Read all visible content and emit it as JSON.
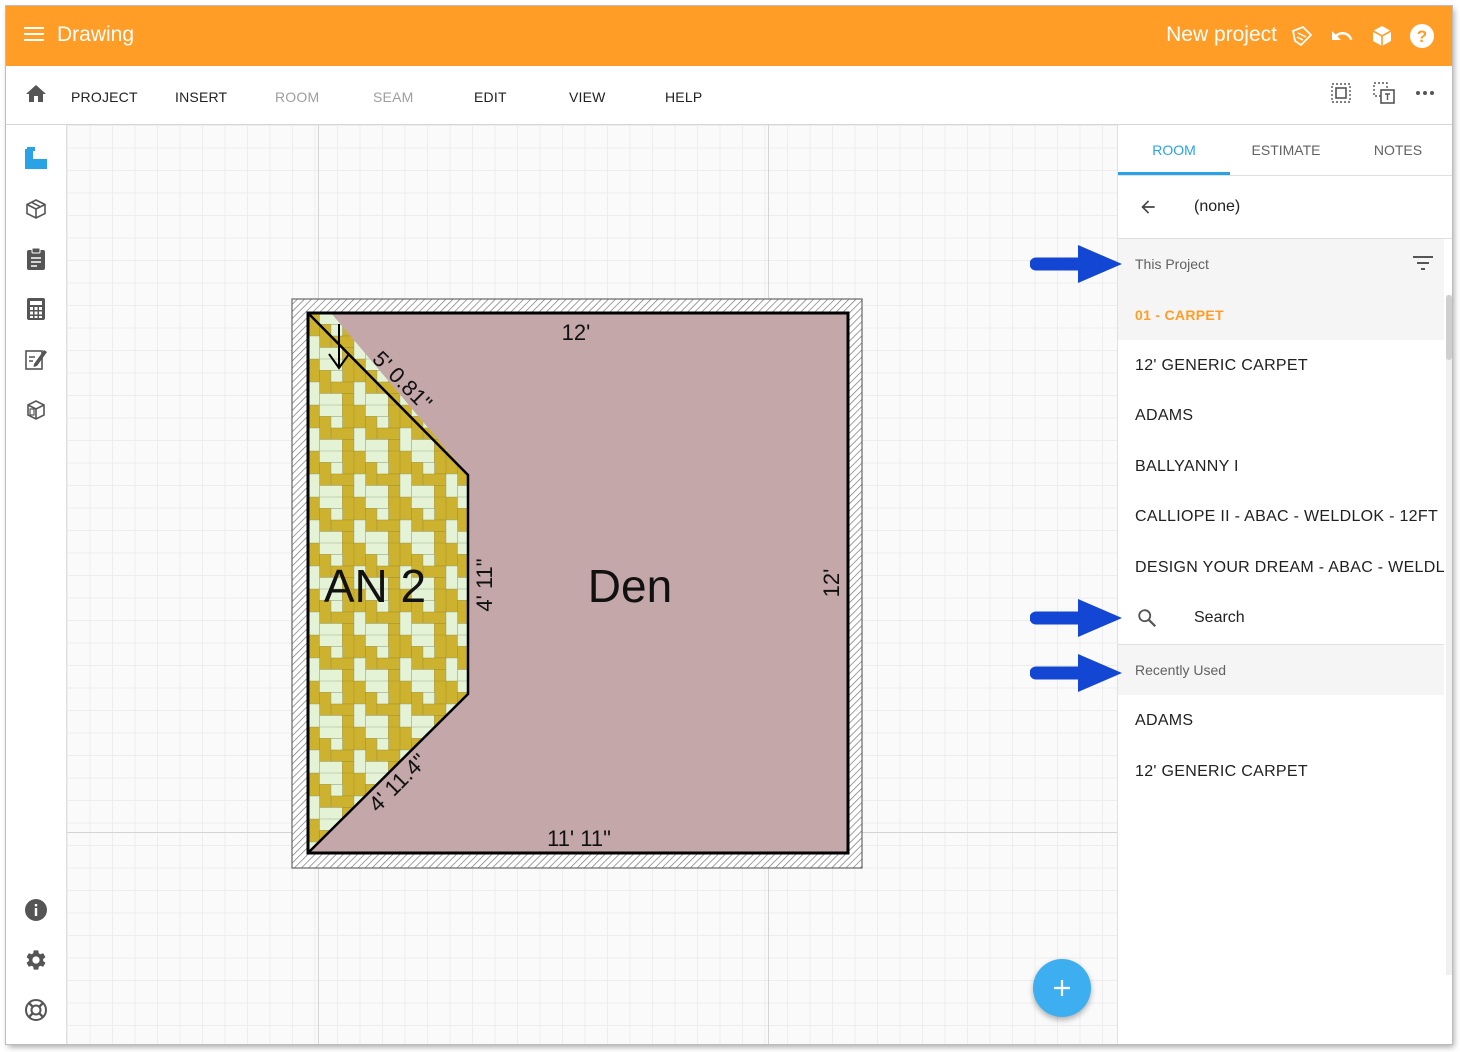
{
  "appbar": {
    "menu_icon": "hamburger-menu-icon",
    "title": "Drawing",
    "project_name": "New project",
    "icons": [
      "sketch-pencil-icon",
      "undo-icon",
      "3d-cube-icon",
      "help-icon"
    ],
    "color": "#ff9d26"
  },
  "menubar": {
    "home_icon": "home-icon",
    "items": [
      {
        "label": "PROJECT",
        "enabled": true
      },
      {
        "label": "INSERT",
        "enabled": true
      },
      {
        "label": "ROOM",
        "enabled": false
      },
      {
        "label": "SEAM",
        "enabled": false
      },
      {
        "label": "EDIT",
        "enabled": true
      },
      {
        "label": "VIEW",
        "enabled": true
      },
      {
        "label": "HELP",
        "enabled": true
      }
    ],
    "right_icons": [
      "fit-to-screen-icon",
      "fit-selection-icon",
      "more-icon"
    ]
  },
  "rail": {
    "top_icons": [
      "floor-plan-icon",
      "3d-box-icon",
      "clipboard-icon",
      "calculator-icon",
      "edit-notes-icon",
      "products-icon"
    ],
    "bottom_icons": [
      "info-icon",
      "settings-icon",
      "support-icon"
    ]
  },
  "canvas": {
    "room_name": "Den",
    "area_name": "AN 2",
    "dimensions": {
      "top": "12'",
      "right": "12'",
      "bottom": "11' 11\"",
      "diagonal_top": "5' 0.81\"",
      "vertical_inner": "4' 11\"",
      "diagonal_bottom": "4' 11.4\""
    },
    "fab_label": "+",
    "colors": {
      "room_fill": "#c4a7a8",
      "tile_gold": "#cdb230",
      "tile_light": "#e4f3d6"
    }
  },
  "panel": {
    "tabs": [
      {
        "label": "ROOM",
        "active": true
      },
      {
        "label": "ESTIMATE",
        "active": false
      },
      {
        "label": "NOTES",
        "active": false
      }
    ],
    "current_selection": "(none)",
    "sections": {
      "this_project": {
        "title": "This Project",
        "items": [
          "01 - CARPET",
          "12' GENERIC CARPET",
          "ADAMS",
          "BALLYANNY I",
          "CALLIOPE II - ABAC - WELDLOK - 12FT",
          "DESIGN YOUR DREAM - ABAC - WELDL"
        ],
        "selected": "01 - CARPET"
      },
      "search": {
        "label": "Search"
      },
      "recently_used": {
        "title": "Recently Used",
        "items": [
          "ADAMS",
          "12' GENERIC CARPET"
        ]
      }
    },
    "accent": "#29a3e6"
  },
  "annotations": {
    "arrow_color": "#1446d4"
  }
}
